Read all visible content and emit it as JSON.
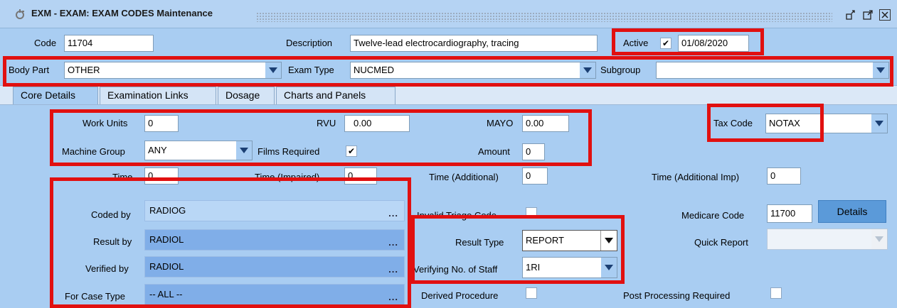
{
  "window": {
    "title": "EXM - EXAM: EXAM CODES Maintenance",
    "buttons": [
      "restore-icon",
      "maximize-icon",
      "close-icon"
    ]
  },
  "header": {
    "code_label": "Code",
    "code_value": "11704",
    "description_label": "Description",
    "description_value": "Twelve-lead electrocardiography, tracing",
    "active_label": "Active",
    "active_checked": true,
    "active_check_glyph": "✔",
    "active_date": "01/08/2020",
    "body_part_label": "Body Part",
    "body_part_value": "OTHER",
    "exam_type_label": "Exam Type",
    "exam_type_value": "NUCMED",
    "subgroup_label": "Subgroup",
    "subgroup_value": ""
  },
  "tabs": [
    {
      "label": "Core Details",
      "active": true
    },
    {
      "label": "Examination Links",
      "active": false
    },
    {
      "label": "Dosage",
      "active": false
    },
    {
      "label": "Charts and Panels",
      "active": false
    }
  ],
  "core": {
    "work_units_label": "Work Units",
    "work_units_value": "0",
    "rvu_label": "RVU",
    "rvu_value": "0.00",
    "mayo_label": "MAYO",
    "mayo_value": "0.00",
    "tax_code_label": "Tax Code",
    "tax_code_value": "NOTAX",
    "machine_group_label": "Machine Group",
    "machine_group_value": "ANY",
    "films_required_label": "Films Required",
    "films_required_checked": true,
    "films_required_glyph": "✔",
    "amount_label": "Amount",
    "amount_value": "0",
    "time_label": "Time",
    "time_value": "0",
    "time_impaired_label": "Time (Impaired)",
    "time_impaired_value": "0",
    "time_additional_label": "Time (Additional)",
    "time_additional_value": "0",
    "time_additional_imp_label": "Time (Additional Imp)",
    "time_additional_imp_value": "0",
    "coded_by_label": "Coded by",
    "coded_by_value": "RADIOG",
    "result_by_label": "Result by",
    "result_by_value": "RADIOL",
    "verified_by_label": "Verified by",
    "verified_by_value": "RADIOL",
    "for_case_type_label": "For Case Type",
    "for_case_type_value": "-- ALL --",
    "lookup_glyph": "...",
    "invalid_triage_label": "Invalid Triage Code",
    "invalid_triage_checked": false,
    "result_type_label": "Result Type",
    "result_type_value": "REPORT",
    "verifying_staff_label": "Verifying No. of Staff",
    "verifying_staff_value": "1RI",
    "derived_procedure_label": "Derived Procedure",
    "derived_procedure_checked": false,
    "medicare_code_label": "Medicare Code",
    "medicare_code_value": "11700",
    "details_button_label": "Details",
    "quick_report_label": "Quick Report",
    "quick_report_value": "",
    "post_processing_label": "Post Processing Required",
    "post_processing_checked": false
  },
  "colors": {
    "background": "#a9cdf2",
    "highlight_box": "#e11010",
    "button": "#5b9ad9"
  }
}
